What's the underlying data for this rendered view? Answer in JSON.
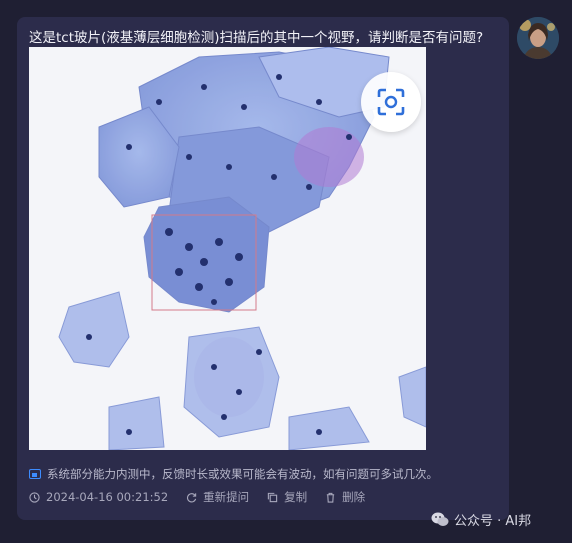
{
  "message": {
    "question": "这是tct玻片(液基薄层细胞检测)扫描后的其中一个视野，请判断是否有问题?",
    "notice": "系统部分能力内测中，反馈时长或效果可能会有波动，如有问题可多试几次。",
    "timestamp": "2024-04-16 00:21:52",
    "actions": {
      "regenerate": "重新提问",
      "copy": "复制",
      "delete": "删除"
    }
  },
  "watermark": {
    "text": "公众号 · AI邦"
  },
  "colors": {
    "background": "#1f1f33",
    "bubble": "#2c2c4b",
    "accent": "#3d8cff"
  },
  "icons": [
    "scan-icon",
    "chat-notice-icon",
    "clock-icon",
    "refresh-icon",
    "copy-icon",
    "trash-icon",
    "wechat-icon"
  ]
}
